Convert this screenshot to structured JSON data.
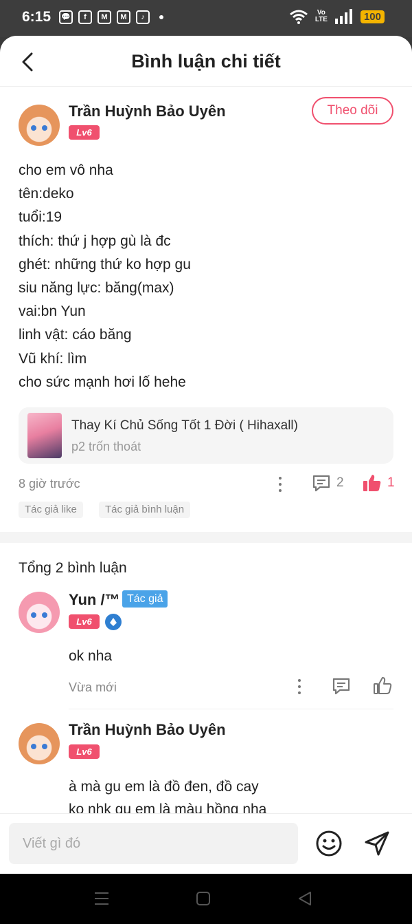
{
  "status_bar": {
    "time": "6:15",
    "app_icons": [
      "💬",
      "f",
      "M",
      "M",
      "♪"
    ],
    "volte_top": "Vo",
    "volte_bottom": "LTE",
    "battery": "100"
  },
  "header": {
    "title": "Bình luận chi tiết",
    "back_icon": "chevron-left-icon"
  },
  "post": {
    "author": "Trần Huỳnh Bảo Uyên",
    "level": "Lv6",
    "follow_label": "Theo dõi",
    "lines": [
      "cho em vô nha",
      "tên:deko",
      "tuổi:19",
      "thích: thứ j hợp gù là đc",
      "ghét: những thứ ko hợp gu",
      "siu năng lực: băng(max)",
      "vai:bn Yun",
      "linh vật: cáo băng",
      "Vũ khí: lìm",
      "cho sức mạnh hơi lố hehe"
    ],
    "story": {
      "title": "Thay Kí Chủ Sống Tốt 1 Đời ( Hihaxall)",
      "chapter": "p2 trốn thoát"
    },
    "time": "8 giờ trước",
    "comment_count": "2",
    "like_count": "1",
    "tags": [
      "Tác giả like",
      "Tác giả bình luận"
    ]
  },
  "total_label": "Tổng 2 bình luận",
  "replies": [
    {
      "author": "Yun /™",
      "author_tag": "Tác giả",
      "level": "Lv6",
      "text": "ok nha",
      "time": "Vừa mới"
    },
    {
      "author": "Trần Huỳnh Bảo Uyên",
      "level": "Lv6",
      "text_lines": [
        "à mà gu em là đồ đen, đồ cay",
        "ko nhk gu em là màu hồng nha"
      ]
    }
  ],
  "input": {
    "placeholder": "Viết gì đó"
  },
  "colors": {
    "accent": "#f0506e",
    "author_tag": "#4aa3e8",
    "battery": "#f4b400"
  }
}
